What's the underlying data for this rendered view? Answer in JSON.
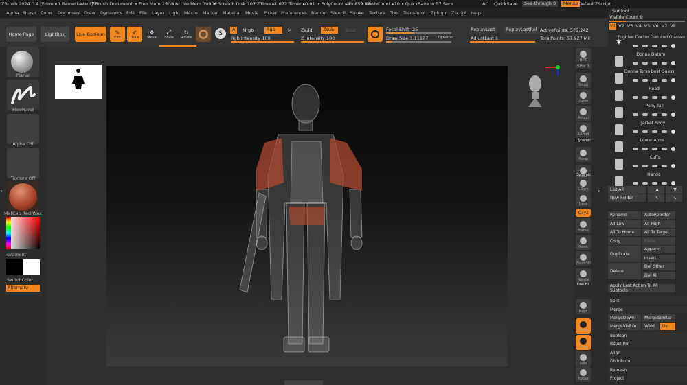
{
  "titlebar": {
    "app": "ZBrush 2024.0.4 [Edmund Barnett-Ward]",
    "doc": "ZBrush Document",
    "free_mem": "• Free Mem 25GB",
    "active_mem": "• Active Mem 30906",
    "scratch": "• Scratch Disk 107",
    "ztime": "• ZTime ▸1.672 Timer ▸0.01",
    "polycount": "• PolyCount ▸49.859 MP",
    "meshcount": "• MeshCount ▸10",
    "quicksave_timer": "• QuickSave In 57 Secs",
    "ac": "AC",
    "quicksave": "QuickSave",
    "see_through": "See-through  0",
    "menus": "Menus",
    "script": "DefaultZScript"
  },
  "menubar": [
    "Alpha",
    "Brush",
    "Color",
    "Document",
    "Draw",
    "Dynamics",
    "Edit",
    "File",
    "Layer",
    "Light",
    "Macro",
    "Marker",
    "Material",
    "Movie",
    "Picker",
    "Preferences",
    "Render",
    "Stencil",
    "Stroke",
    "Texture",
    "Tool",
    "Transform",
    "Zplugin",
    "Zscript",
    "Help"
  ],
  "toolbar": {
    "home": "Home Page",
    "lightbox": "LightBox",
    "live_boolean": "Live Boolean",
    "edit": "Edit",
    "draw": "Draw",
    "move": "Move",
    "scale": "Scale",
    "rotate": "Rotate",
    "a": "A",
    "mrgb": "Mrgb",
    "rgb": "Rgb",
    "m": "M",
    "rgb_intensity": "Rgb Intensity 100",
    "zadd": "Zadd",
    "zsub": "Zsub",
    "zcut": "Zcut",
    "z_intensity": "Z Intensity 100",
    "focal_shift": "Focal Shift -25",
    "draw_size": "Draw Size 3.11177",
    "dynamic": "Dynamic",
    "replay_last": "ReplayLast",
    "replay_last_rel": "ReplayLastRel",
    "adjust_last": "AdjustLast 1",
    "active_points": "ActivePoints: 579.242",
    "total_points": "TotalPoints: 57.927 Mil",
    "rgb_intensity_fill": 1.0,
    "z_intensity_fill": 1.0
  },
  "leftshelf": {
    "brush": "Planar",
    "stroke": "FreeHand",
    "alpha": "Alpha Off",
    "texture": "Texture Off",
    "material": "MatCap Red Wax",
    "gradient": "Gradient",
    "switch": "SwitchColor",
    "alternate": "Alternate"
  },
  "rightshelf": [
    "BPR",
    "SPix 3",
    "Scroll",
    "Zoom",
    "Actual",
    "AAHalf",
    "Dynamic",
    "Persp",
    "Floor",
    "Dynamic",
    "L.Sym",
    "Local",
    "Qxyz",
    "Frame",
    "Move",
    "Zoom3D",
    "Rotate",
    "Line Fill",
    "PolyF",
    "Transp",
    "Ghost",
    "Solo",
    "Xpose"
  ],
  "panel": {
    "header": "Subtool",
    "visible_count": "Visible Count 9",
    "levels": [
      "V1",
      "V2",
      "V3",
      "V4",
      "V5",
      "V6",
      "V7",
      "V8"
    ],
    "subtools": [
      "Fugitive Doctor Gun and Glasses",
      "Donna Datum",
      "Donna Torso Best Guess",
      "Head",
      "Pony Tail",
      "Jacket Body",
      "Lower Arms",
      "Cuffs",
      "Hands"
    ],
    "list_all": "List All",
    "new_folder": "New Folder",
    "rename": "Rename",
    "auto_reorder": "AutoReorder",
    "all_low": "All Low",
    "all_high": "All High",
    "all_to_home": "All To Home",
    "all_to_target": "All To Target",
    "copy": "Copy",
    "paste": "Paste",
    "duplicate": "Duplicate",
    "append": "Append",
    "insert": "Insert",
    "delete": "Delete",
    "del_other": "Del Other",
    "del_all": "Del All",
    "apply_last": "Apply Last Action To All Subtools",
    "split": "Split",
    "merge": "Merge",
    "merge_down": "MergeDown",
    "merge_similar": "MergeSimilar",
    "merge_visible": "MergeVisible",
    "weld": "Weld",
    "uv": "Uv",
    "boolean": "Boolean",
    "bevel_pro": "Bevel Pro",
    "align": "Align",
    "distribute": "Distribute",
    "remesh": "Remesh",
    "project": "Project"
  },
  "colors": {
    "accent": "#f0861d",
    "wax": "#b04a30"
  }
}
